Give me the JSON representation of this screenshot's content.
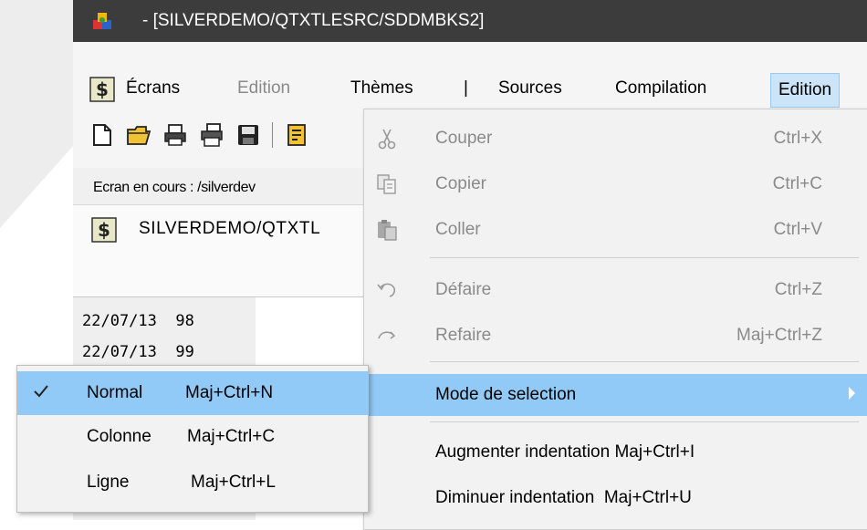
{
  "window": {
    "title": " - [SILVERDEMO/QTXTLESRC/SDDMBKS2]"
  },
  "menubar": {
    "items": [
      {
        "label": "Écrans",
        "enabled": true
      },
      {
        "label": "Edition",
        "enabled": false
      },
      {
        "label": "Thèmes",
        "enabled": true
      },
      {
        "label": "|",
        "enabled": true
      },
      {
        "label": "Sources",
        "enabled": true
      },
      {
        "label": "Compilation",
        "enabled": true
      },
      {
        "label": "Edition",
        "enabled": true,
        "open": true
      }
    ]
  },
  "toolbar": {
    "icons": [
      "new-file-icon",
      "open-folder-icon",
      "print-icon",
      "print-preview-icon",
      "save-icon",
      "source-icon"
    ]
  },
  "status": {
    "text": "Ecran en cours :  /silverdev"
  },
  "tab": {
    "label": "SILVERDEMO/QTXTL"
  },
  "editor": {
    "lines": [
      "22/07/13  98",
      "22/07/13  99"
    ]
  },
  "edit_menu": {
    "items": [
      {
        "label": "Couper",
        "shortcut": "Ctrl+X",
        "icon": "scissors-icon",
        "enabled": false
      },
      {
        "label": "Copier",
        "shortcut": "Ctrl+C",
        "icon": "copy-icon",
        "enabled": false
      },
      {
        "label": "Coller",
        "shortcut": "Ctrl+V",
        "icon": "paste-icon",
        "enabled": false
      },
      {
        "label": "Défaire",
        "shortcut": "Ctrl+Z",
        "icon": "undo-icon",
        "enabled": false
      },
      {
        "label": "Refaire",
        "shortcut": "Maj+Ctrl+Z",
        "icon": "redo-icon",
        "enabled": false
      },
      {
        "label": "Mode de selection",
        "shortcut": "",
        "icon": "",
        "enabled": true,
        "submenu": true,
        "highlighted": true
      },
      {
        "label": "Augmenter indentation Maj+Ctrl+I",
        "shortcut": "",
        "icon": "",
        "enabled": true
      },
      {
        "label": "Diminuer indentation  Maj+Ctrl+U",
        "shortcut": "",
        "icon": "",
        "enabled": true
      }
    ]
  },
  "selection_submenu": {
    "items": [
      {
        "label": "Normal",
        "shortcut": "Maj+Ctrl+N",
        "checked": true
      },
      {
        "label": "Colonne",
        "shortcut": "Maj+Ctrl+C",
        "checked": false
      },
      {
        "label": "Ligne",
        "shortcut": "Maj+Ctrl+L",
        "checked": false
      }
    ]
  },
  "colors": {
    "titlebar": "#3c3c3c",
    "highlight": "#91c9f7",
    "menubar_active": "#cce4f7",
    "disabled_text": "#8a8a8a"
  }
}
